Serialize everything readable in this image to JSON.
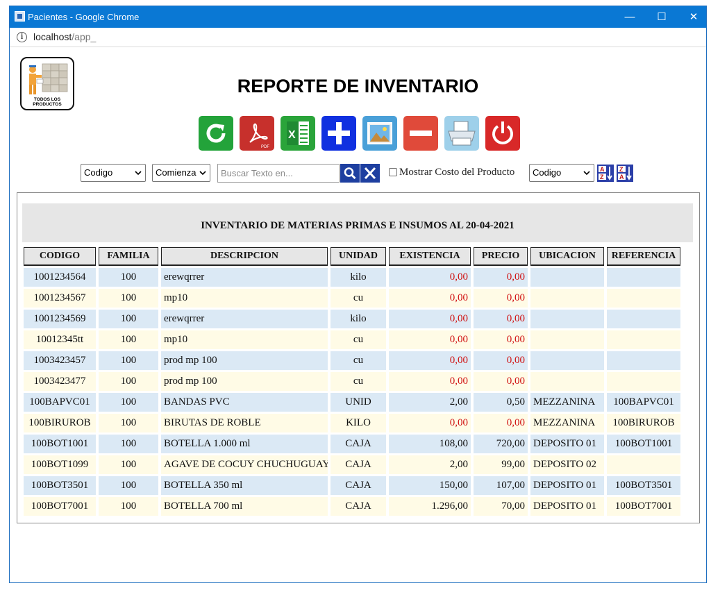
{
  "window": {
    "title": "Pacientes - Google Chrome",
    "url_host": "localhost",
    "url_path": "/app_"
  },
  "logo": {
    "text": "TODOS LOS PRODUCTOS"
  },
  "page": {
    "title": "REPORTE DE INVENTARIO"
  },
  "toolbar": [
    {
      "name": "refresh-button",
      "icon": "refresh-icon",
      "color": "#23a33a"
    },
    {
      "name": "pdf-button",
      "icon": "pdf-icon",
      "color": "#c7302c"
    },
    {
      "name": "excel-button",
      "icon": "excel-icon",
      "color": "#2aa43a"
    },
    {
      "name": "add-button",
      "icon": "plus-icon",
      "color": "#1030e0"
    },
    {
      "name": "image-button",
      "icon": "image-icon",
      "color": "#4aa0d8"
    },
    {
      "name": "remove-button",
      "icon": "minus-icon",
      "color": "#e04a3a"
    },
    {
      "name": "print-button",
      "icon": "printer-icon",
      "color": "#9ed0ea"
    },
    {
      "name": "exit-button",
      "icon": "power-icon",
      "color": "#d82828"
    }
  ],
  "filters": {
    "field_select": "Codigo",
    "match_select": "Comienza",
    "search_placeholder": "Buscar Texto en...",
    "show_cost_label": "Mostrar Costo del Producto",
    "sort_select": "Codigo"
  },
  "report": {
    "heading": "INVENTARIO DE MATERIAS PRIMAS E INSUMOS AL 20-04-2021",
    "columns": [
      "CODIGO",
      "FAMILIA",
      "DESCRIPCION",
      "UNIDAD",
      "EXISTENCIA",
      "PRECIO",
      "UBICACION",
      "REFERENCIA"
    ],
    "rows": [
      {
        "codigo": "1001234564",
        "familia": "100",
        "descripcion": "erewqrrer",
        "unidad": "kilo",
        "existencia": "0,00",
        "precio": "0,00",
        "ubicacion": "",
        "referencia": ""
      },
      {
        "codigo": "1001234567",
        "familia": "100",
        "descripcion": "mp10",
        "unidad": "cu",
        "existencia": "0,00",
        "precio": "0,00",
        "ubicacion": "",
        "referencia": ""
      },
      {
        "codigo": "1001234569",
        "familia": "100",
        "descripcion": "erewqrrer",
        "unidad": "kilo",
        "existencia": "0,00",
        "precio": "0,00",
        "ubicacion": "",
        "referencia": ""
      },
      {
        "codigo": "10012345tt",
        "familia": "100",
        "descripcion": "mp10",
        "unidad": "cu",
        "existencia": "0,00",
        "precio": "0,00",
        "ubicacion": "",
        "referencia": ""
      },
      {
        "codigo": "1003423457",
        "familia": "100",
        "descripcion": "prod mp 100",
        "unidad": "cu",
        "existencia": "0,00",
        "precio": "0,00",
        "ubicacion": "",
        "referencia": ""
      },
      {
        "codigo": "1003423477",
        "familia": "100",
        "descripcion": "prod mp 100",
        "unidad": "cu",
        "existencia": "0,00",
        "precio": "0,00",
        "ubicacion": "",
        "referencia": ""
      },
      {
        "codigo": "100BAPVC01",
        "familia": "100",
        "descripcion": "BANDAS PVC",
        "unidad": "UNID",
        "existencia": "2,00",
        "precio": "0,50",
        "ubicacion": "MEZZANINA",
        "referencia": "100BAPVC01"
      },
      {
        "codigo": "100BIRUROB",
        "familia": "100",
        "descripcion": "BIRUTAS DE ROBLE",
        "unidad": "KILO",
        "existencia": "0,00",
        "precio": "0,00",
        "ubicacion": "MEZZANINA",
        "referencia": "100BIRUROB"
      },
      {
        "codigo": "100BOT1001",
        "familia": "100",
        "descripcion": "BOTELLA 1.000 ml",
        "unidad": "CAJA",
        "existencia": "108,00",
        "precio": "720,00",
        "ubicacion": "DEPOSITO 01",
        "referencia": "100BOT1001"
      },
      {
        "codigo": "100BOT1099",
        "familia": "100",
        "descripcion": "AGAVE DE COCUY CHUCHUGUAYA",
        "unidad": "CAJA",
        "existencia": "2,00",
        "precio": "99,00",
        "ubicacion": "DEPOSITO 02",
        "referencia": ""
      },
      {
        "codigo": "100BOT3501",
        "familia": "100",
        "descripcion": "BOTELLA 350 ml",
        "unidad": "CAJA",
        "existencia": "150,00",
        "precio": "107,00",
        "ubicacion": "DEPOSITO 01",
        "referencia": "100BOT3501"
      },
      {
        "codigo": "100BOT7001",
        "familia": "100",
        "descripcion": "BOTELLA 700 ml",
        "unidad": "CAJA",
        "existencia": "1.296,00",
        "precio": "70,00",
        "ubicacion": "DEPOSITO 01",
        "referencia": "100BOT7001"
      }
    ]
  }
}
